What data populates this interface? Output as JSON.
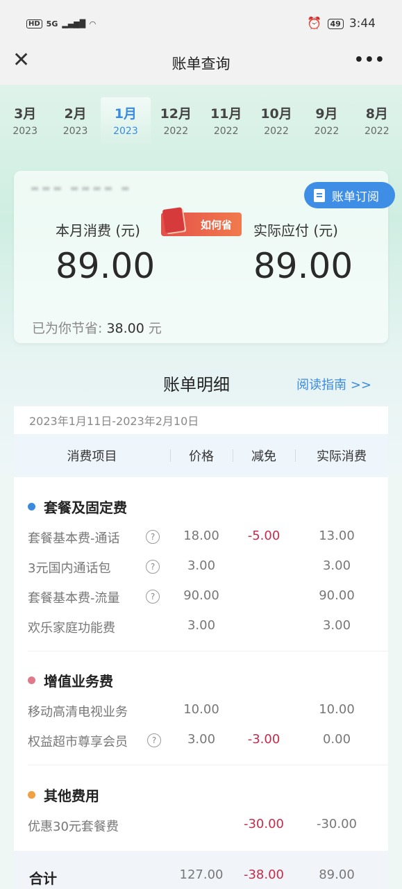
{
  "status_bar": {
    "network": "HD",
    "signal": "5G",
    "battery": "49",
    "time": "3:44"
  },
  "nav": {
    "title": "账单查询"
  },
  "months": [
    {
      "month": "3月",
      "year": "2023"
    },
    {
      "month": "2月",
      "year": "2023"
    },
    {
      "month": "1月",
      "year": "2023",
      "active": true
    },
    {
      "month": "12月",
      "year": "2022"
    },
    {
      "month": "11月",
      "year": "2022"
    },
    {
      "month": "10月",
      "year": "2022"
    },
    {
      "month": "9月",
      "year": "2022"
    },
    {
      "month": "8月",
      "year": "2022"
    }
  ],
  "summary": {
    "subscribe_label": "账单订阅",
    "monthly_label": "本月消费 (元)",
    "actual_label": "实际应付 (元)",
    "how_save_label": "如何省",
    "monthly_amount": "89.00",
    "actual_amount": "89.00",
    "saved_prefix": "已为你节省:",
    "saved_value": "38.00",
    "saved_unit": "元"
  },
  "detail": {
    "title": "账单明细",
    "guide_link": "阅读指南 >>",
    "period": "2023年1月11日-2023年2月10日",
    "headers": {
      "item": "消费项目",
      "price": "价格",
      "discount": "减免",
      "actual": "实际消费"
    },
    "groups": [
      {
        "title": "套餐及固定费",
        "color": "#3a8ae0",
        "rows": [
          {
            "name": "套餐基本费-通话",
            "price": "18.00",
            "discount": "-5.00",
            "actual": "13.00"
          },
          {
            "name": "3元国内通话包",
            "price": "3.00",
            "discount": "",
            "actual": "3.00"
          },
          {
            "name": "套餐基本费-流量",
            "price": "90.00",
            "discount": "",
            "actual": "90.00"
          },
          {
            "name": "欢乐家庭功能费",
            "price": "3.00",
            "discount": "",
            "actual": "3.00"
          }
        ]
      },
      {
        "title": "增值业务费",
        "color": "#e07a8a",
        "rows": [
          {
            "name": "移动高清电视业务",
            "price": "10.00",
            "discount": "",
            "actual": "10.00"
          },
          {
            "name": "权益超市尊享会员",
            "price": "3.00",
            "discount": "-3.00",
            "actual": "0.00"
          }
        ]
      },
      {
        "title": "其他费用",
        "color": "#f0a040",
        "rows": [
          {
            "name": "优惠30元套餐费",
            "price": "",
            "discount": "-30.00",
            "actual": "-30.00"
          }
        ]
      }
    ],
    "total": {
      "name": "合计",
      "price": "127.00",
      "discount": "-38.00",
      "actual": "89.00"
    }
  },
  "colors": {
    "accent": "#3a8ae0",
    "discount": "#c72b4a",
    "subscribe_bg": "#3f8ee6"
  }
}
